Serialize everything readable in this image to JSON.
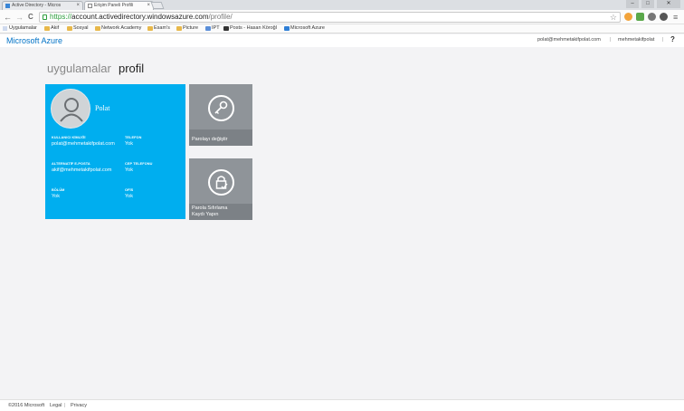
{
  "tabs": [
    {
      "title": "Active Directory - Micros",
      "close": "×"
    },
    {
      "title": "Erişim Paneli Profili",
      "close": "×"
    }
  ],
  "window_controls": {
    "minimize": "–",
    "maximize": "□",
    "close": "✕"
  },
  "toolbar": {
    "back": "←",
    "forward": "→",
    "reload": "C",
    "url_scheme": "https://",
    "url_host": "account.activedirectory.windowsazure.com",
    "url_path": "/profile/",
    "star": "☆",
    "menu": "≡"
  },
  "bookmarks": [
    "Uygulamalar",
    "Akif",
    "Sosyal",
    "Network Academy",
    "Esam's",
    "Picture",
    "IPT",
    "Posts - Hasan Köroğl",
    "Microsoft Azure"
  ],
  "header": {
    "brand": "Microsoft Azure",
    "email": "polat@mehmetakifpolat.com",
    "separator": "|",
    "username": "mehmetakifpolat",
    "help": "?"
  },
  "breadcrumb": {
    "apps": "uygulamalar",
    "current": "profil"
  },
  "profile": {
    "name": "Polat",
    "fields": [
      {
        "label": "KULLANICI KİMLİĞİ",
        "value": "polat@mehmetakifpolat.com"
      },
      {
        "label": "TELEFON",
        "value": "Yok"
      },
      {
        "label": "ALTERNATİF E-POSTA",
        "value": "akif@mehmetakifpolat.com"
      },
      {
        "label": "CEP TELEFONU",
        "value": "Yok"
      },
      {
        "label": "BÖLÜM",
        "value": "Yok"
      },
      {
        "label": "OFİS",
        "value": "Yok"
      }
    ]
  },
  "tiles": {
    "change_password": "Parolayı değiştir",
    "password_reset_line1": "Parola Sıfırlama",
    "password_reset_line2": "Kaydı Yapın"
  },
  "footer": {
    "copyright": "©2016 Microsoft",
    "legal": "Legal",
    "sep": "|",
    "privacy": "Privacy"
  },
  "colors": {
    "tile_blue": "#00aeef",
    "tile_gray": "#8f9499",
    "brand_blue": "#0072c6"
  }
}
